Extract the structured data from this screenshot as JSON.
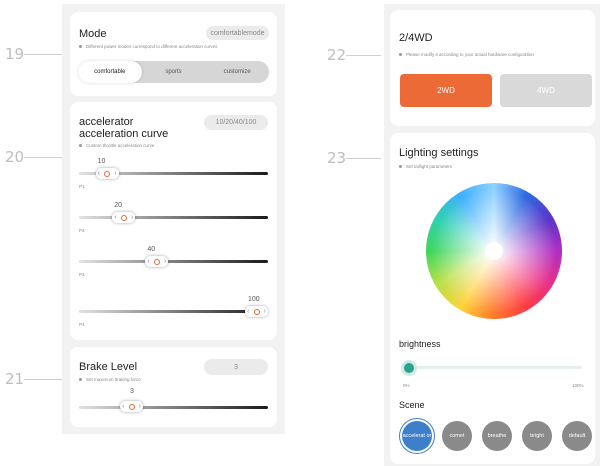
{
  "callouts": [
    "19",
    "20",
    "21",
    "22",
    "23"
  ],
  "mode": {
    "title": "Mode",
    "subtitle": "Different power modes correspond to different acceleration curves",
    "badge": "comfortablemode",
    "options": [
      "comfortable",
      "sports",
      "customize"
    ],
    "selected": "comfortable"
  },
  "accel": {
    "title_line1": "accelerator",
    "title_line2": "acceleration curve",
    "subtitle": "Custom throttle acceleration curve",
    "badge": "10/20/40/100",
    "sliders": [
      {
        "label": "P1",
        "value": "10",
        "level": 10
      },
      {
        "label": "P2",
        "value": "20",
        "level": 20
      },
      {
        "label": "P3",
        "value": "40",
        "level": 40
      },
      {
        "label": "P4",
        "value": "100",
        "level": 100
      }
    ]
  },
  "brake": {
    "title": "Brake Level",
    "subtitle": "Set maximum braking force",
    "badge": "3",
    "value": "3",
    "level": 3
  },
  "drive": {
    "title": "2/4WD",
    "subtitle": "Please modify it according to your actual hardware configuration",
    "options": [
      "2WD",
      "4WD"
    ],
    "selected": "2WD",
    "colors": {
      "active": "#ec6a36",
      "inactive": "#d9d9d9"
    }
  },
  "lighting": {
    "title": "Lighting settings",
    "subtitle": "Set taillight parameters",
    "brightness_label": "brightness",
    "brightness_min": "0%",
    "brightness_max": "100%",
    "brightness_level": 0,
    "scene_label": "Scene",
    "scenes": [
      "accelerator",
      "comet",
      "breathe",
      "bright",
      "default"
    ],
    "scene_display": [
      "accelerat or",
      "comet",
      "breathe",
      "bright",
      "default"
    ],
    "selected_scene": "accelerator",
    "colors": {
      "brightness": "#2aa58c",
      "scene_active": "#3e7fc9"
    }
  },
  "icons": [
    "chevron-left-icon",
    "chevron-right-icon"
  ]
}
